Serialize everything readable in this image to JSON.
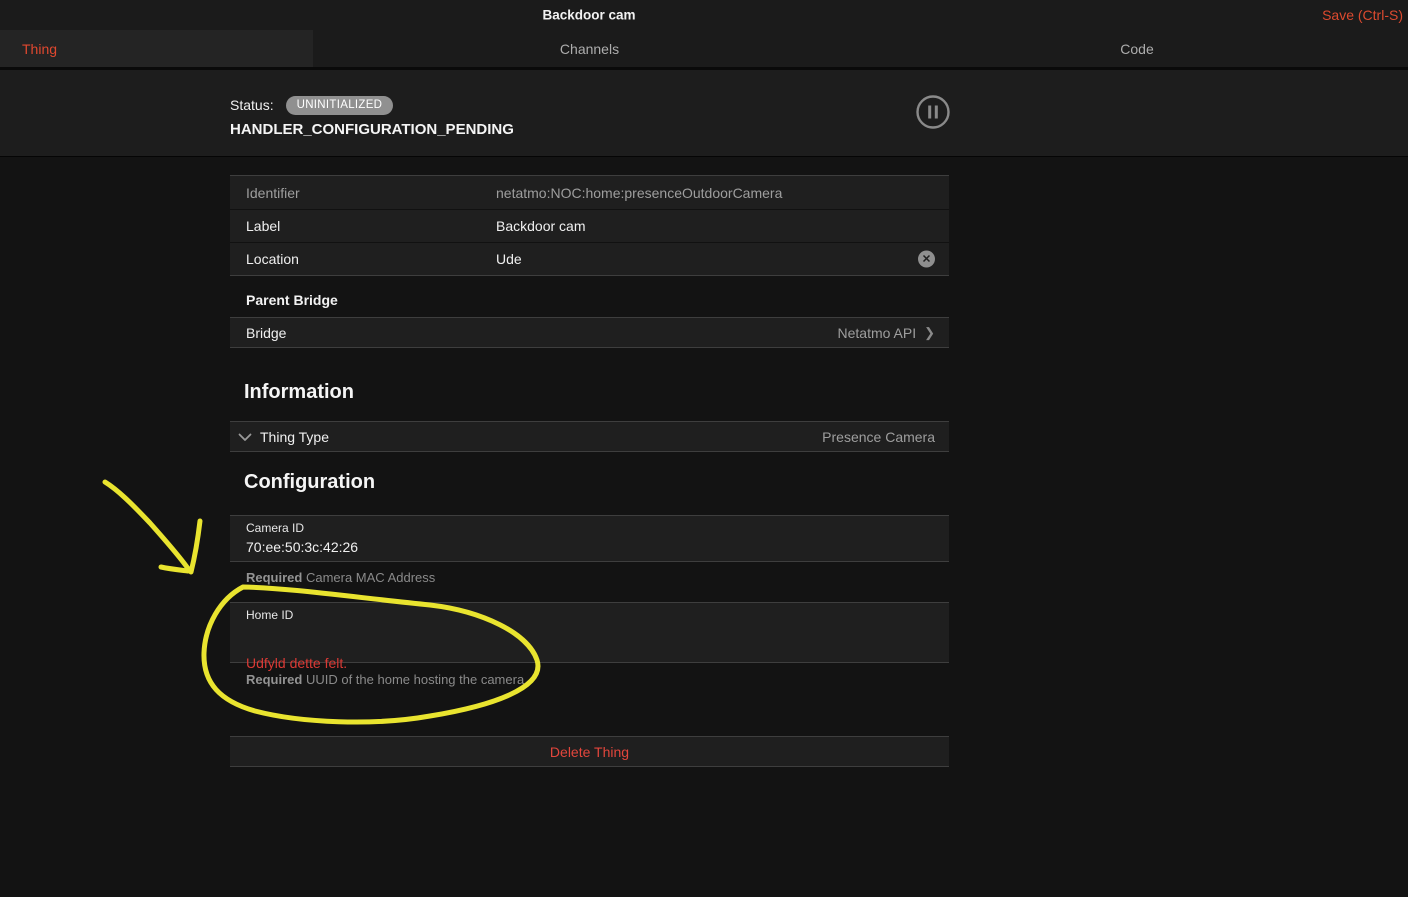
{
  "header": {
    "title": "Backdoor cam",
    "save_label": "Save (Ctrl-S)"
  },
  "tabs": {
    "thing": "Thing",
    "channels": "Channels",
    "code": "Code"
  },
  "status": {
    "label": "Status:",
    "badge": "UNINITIALIZED",
    "detail": "HANDLER_CONFIGURATION_PENDING",
    "pause_icon": "pause-circle-icon"
  },
  "identity_rows": {
    "0": {
      "label": "Identifier",
      "value": "netatmo:NOC:home:presenceOutdoorCamera"
    },
    "1": {
      "label": "Label",
      "value": "Backdoor cam"
    },
    "2": {
      "label": "Location",
      "value": "Ude",
      "clear_icon": "x"
    }
  },
  "parent_bridge": {
    "heading": "Parent Bridge",
    "row_label": "Bridge",
    "row_value": "Netatmo API",
    "chevron": "❯"
  },
  "information": {
    "heading": "Information",
    "row_label": "Thing Type",
    "row_value": "Presence Camera"
  },
  "configuration": {
    "heading": "Configuration",
    "fields": {
      "0": {
        "label": "Camera ID",
        "value": "70:ee:50:3c:42:26",
        "helper_bold": "Required",
        "helper_text": " Camera MAC Address"
      },
      "1": {
        "label": "Home ID",
        "value": "",
        "error": "Udfyld dette felt.",
        "helper_bold": "Required",
        "helper_text": " UUID of the home hosting the camera"
      }
    },
    "delete_label": "Delete Thing"
  },
  "annotation": {
    "color": "#e9e42f",
    "meaning": "hand-drawn arrow and loop highlighting the empty Home ID field"
  },
  "colors": {
    "accent_red": "#e0482f",
    "error_red": "#d93a35",
    "delete_red": "#e2463c",
    "badge_gray": "#909090",
    "page_bg": "#131313",
    "row_bg": "#1f1f1f",
    "bar_bg": "#1b1b1b"
  }
}
